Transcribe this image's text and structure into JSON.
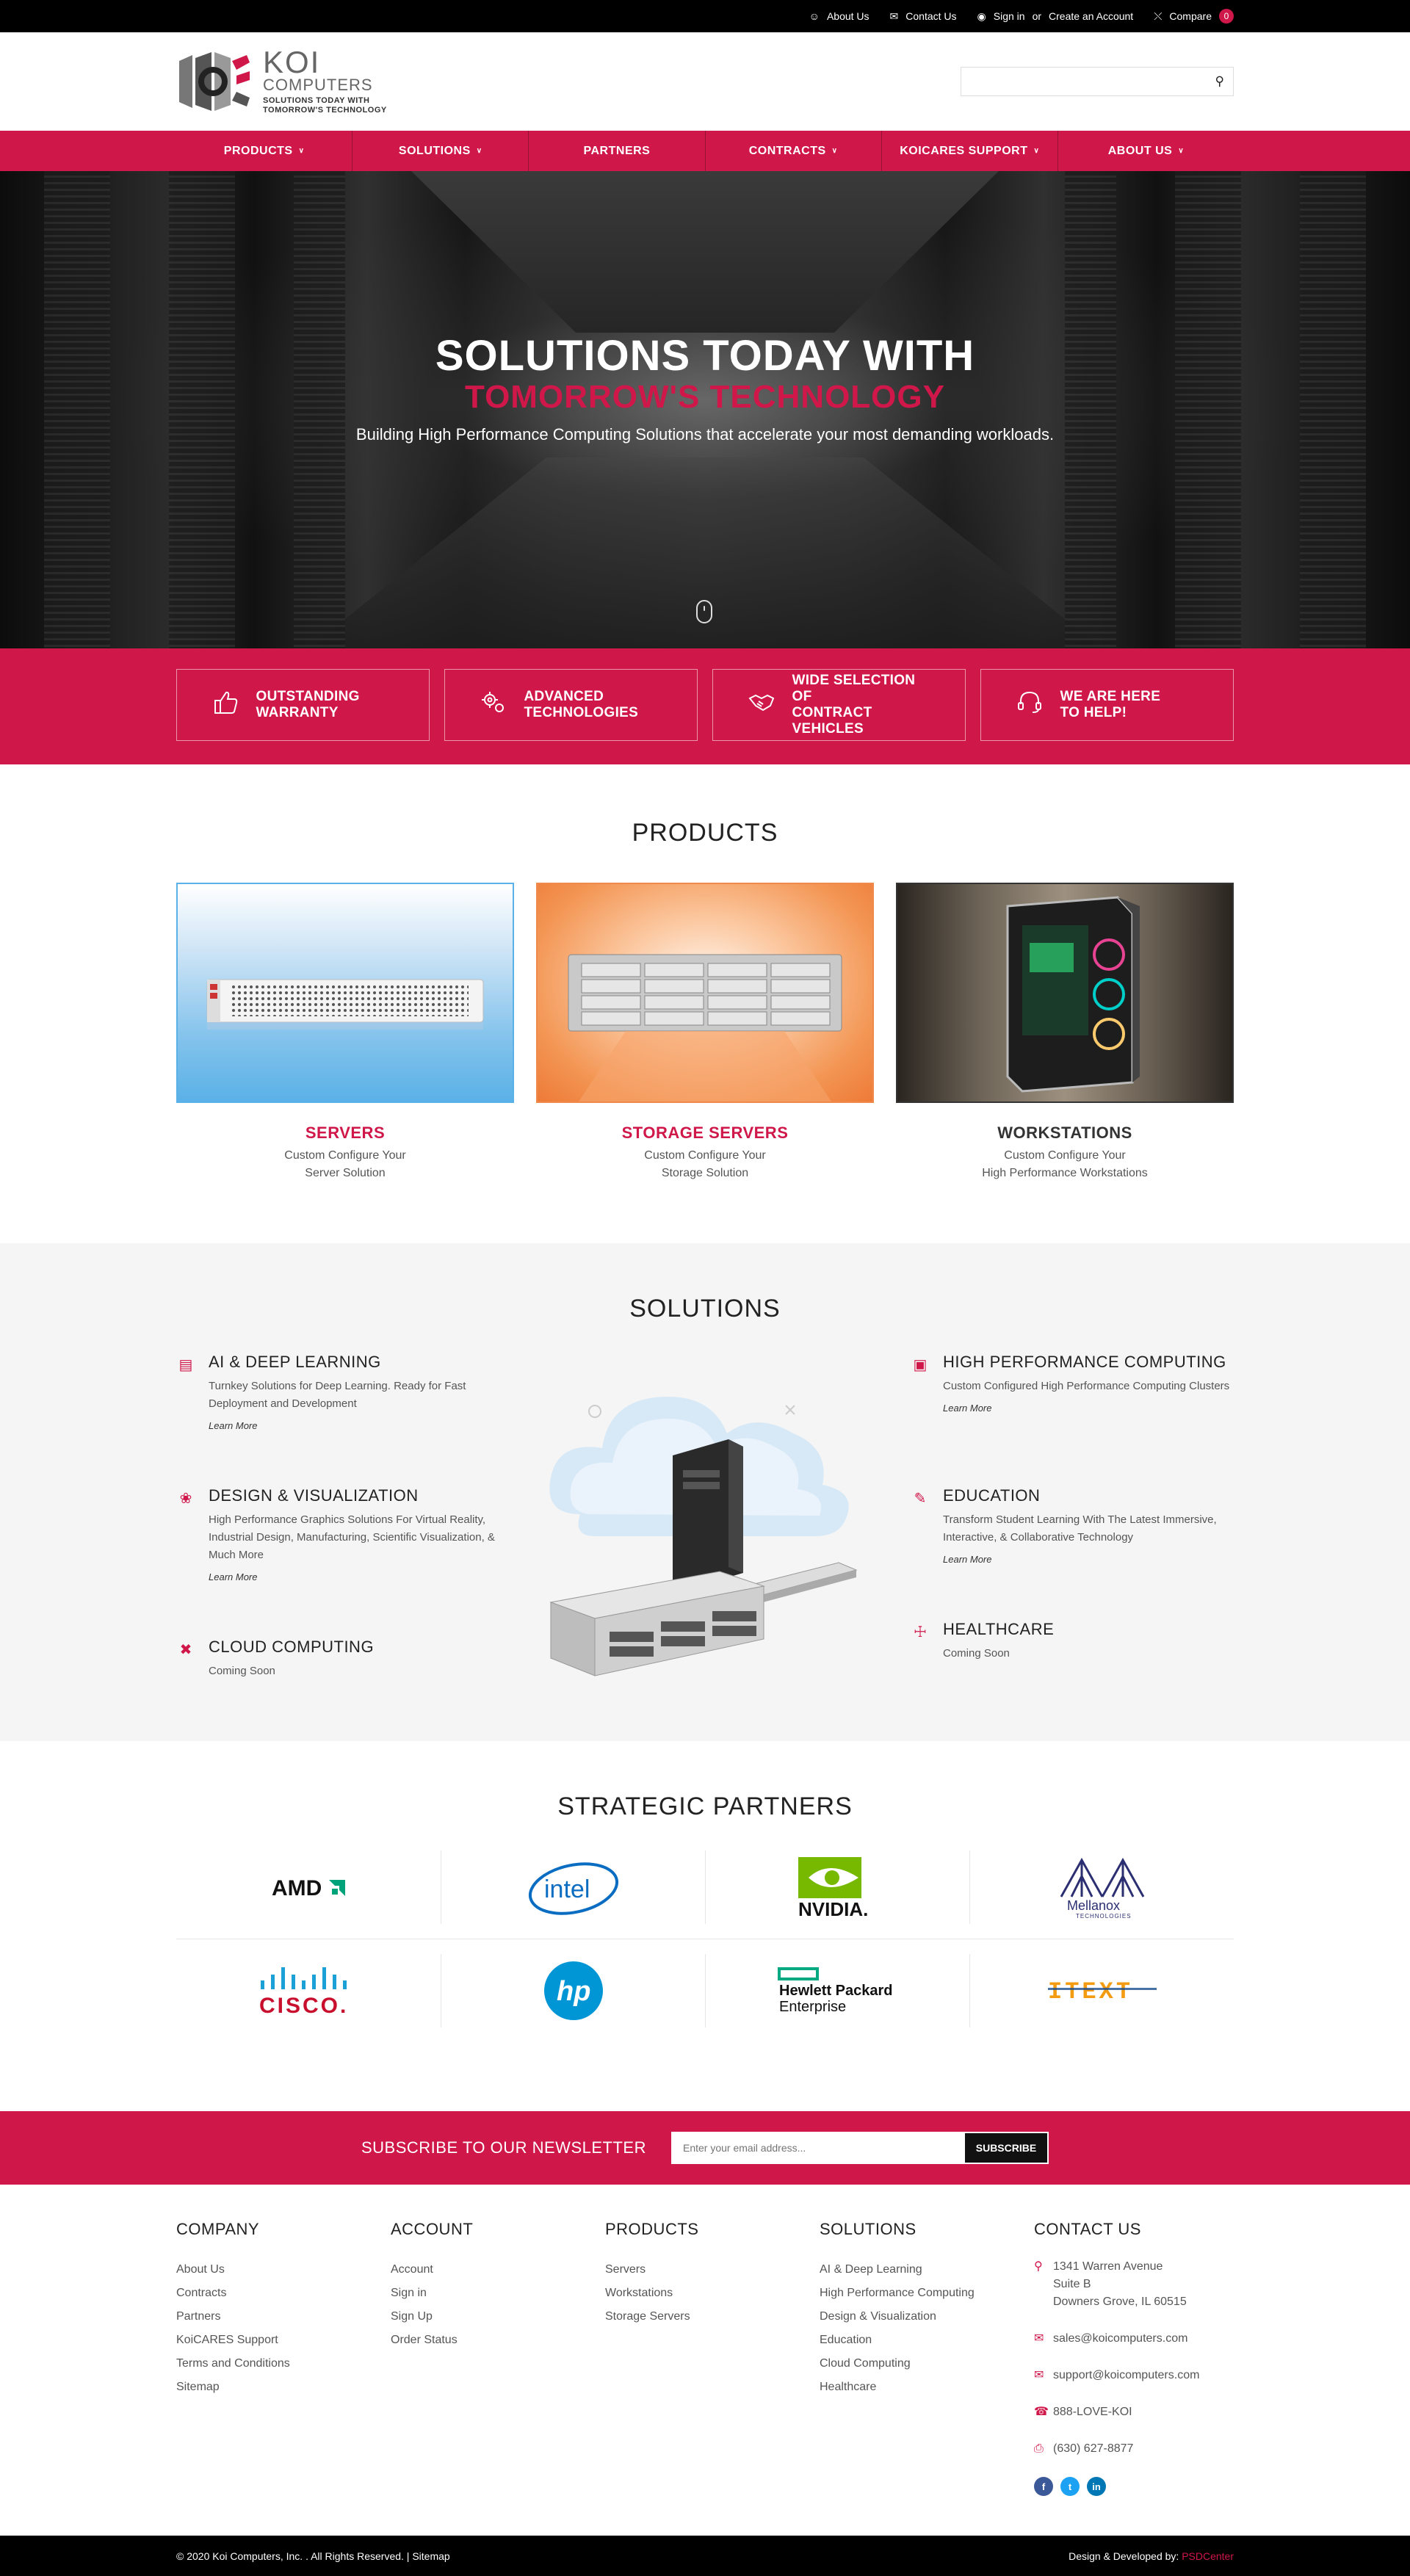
{
  "topbar": {
    "about": "About Us",
    "contact": "Contact Us",
    "signin": "Sign in",
    "or": "or",
    "create": "Create an Account",
    "compare": "Compare",
    "compare_count": "0"
  },
  "header": {
    "logo_koi": "KOI",
    "logo_computers": "COMPUTERS",
    "logo_tag_1": "SOLUTIONS TODAY WITH",
    "logo_tag_2": "TOMORROW'S TECHNOLOGY",
    "search_placeholder": ""
  },
  "nav": [
    "PRODUCTS",
    "SOLUTIONS",
    "PARTNERS",
    "CONTRACTS",
    "KOICARES SUPPORT",
    "ABOUT US"
  ],
  "hero": {
    "line1": "SOLUTIONS TODAY WITH",
    "line2": "TOMORROW'S TECHNOLOGY",
    "subtitle": "Building High Performance Computing Solutions that accelerate your most demanding workloads."
  },
  "features": [
    {
      "icon": "thumbs-up-icon",
      "line1": "OUTSTANDING",
      "line2": "WARRANTY"
    },
    {
      "icon": "gears-icon",
      "line1": "ADVANCED",
      "line2": "TECHNOLOGIES"
    },
    {
      "icon": "handshake-icon",
      "line1": "WIDE SELECTION OF",
      "line2": "CONTRACT VEHICLES"
    },
    {
      "icon": "headset-icon",
      "line1": "WE ARE HERE",
      "line2": "TO HELP!"
    }
  ],
  "products": {
    "title": "PRODUCTS",
    "items": [
      {
        "name": "SERVERS",
        "desc1": "Custom Configure Your",
        "desc2": "Server Solution",
        "color": "#d0174a"
      },
      {
        "name": "STORAGE SERVERS",
        "desc1": "Custom Configure Your",
        "desc2": "Storage Solution",
        "color": "#d0174a"
      },
      {
        "name": "WORKSTATIONS",
        "desc1": "Custom Configure Your",
        "desc2": "High Performance Workstations",
        "color": "#333333"
      }
    ]
  },
  "solutions": {
    "title": "SOLUTIONS",
    "items": [
      {
        "icon": "chip-icon",
        "title": "AI & DEEP LEARNING",
        "desc": "Turnkey Solutions for Deep Learning. Ready for Fast Deployment and Development",
        "more": "Learn More"
      },
      {
        "icon": "palette-icon",
        "title": "DESIGN & VISUALIZATION",
        "desc": "High Performance Graphics Solutions For Virtual Reality, Industrial Design, Manufacturing, Scientific Visualization, & Much More",
        "more": "Learn More"
      },
      {
        "icon": "tools-icon",
        "title": "CLOUD COMPUTING",
        "desc": "Coming Soon",
        "more": ""
      },
      {
        "icon": "laptop-icon",
        "title": "HIGH PERFORMANCE COMPUTING",
        "desc": "Custom Configured High Performance Computing Clusters",
        "more": "Learn More"
      },
      {
        "icon": "pencil-icon",
        "title": "EDUCATION",
        "desc": "Transform Student Learning With The Latest Immersive, Interactive, & Collaborative Technology",
        "more": "Learn More"
      },
      {
        "icon": "medkit-icon",
        "title": "HEALTHCARE",
        "desc": "Coming Soon",
        "more": ""
      }
    ]
  },
  "partners": {
    "title": "STRATEGIC PARTNERS",
    "logos": [
      "AMD",
      "intel",
      "NVIDIA.",
      "Mellanox",
      "CISCO.",
      "hp",
      "Hewlett Packard",
      "Enterprise",
      "ITEXT",
      "TECHNOLOGIES"
    ]
  },
  "newsletter": {
    "label": "SUBSCRIBE TO OUR NEWSLETTER",
    "placeholder": "Enter your email address...",
    "button": "SUBSCRIBE"
  },
  "footer": {
    "company": {
      "title": "COMPANY",
      "links": [
        "About Us",
        "Contracts",
        "Partners",
        "KoiCARES Support",
        "Terms and Conditions",
        "Sitemap"
      ]
    },
    "account": {
      "title": "ACCOUNT",
      "links": [
        "Account",
        "Sign in",
        "Sign Up",
        "Order Status"
      ]
    },
    "products": {
      "title": "PRODUCTS",
      "links": [
        "Servers",
        "Workstations",
        "Storage Servers"
      ]
    },
    "solutions": {
      "title": "SOLUTIONS",
      "links": [
        "AI & Deep Learning",
        "High Performance Computing",
        "Design & Visualization",
        "Education",
        "Cloud Computing",
        "Healthcare"
      ]
    },
    "contact": {
      "title": "CONTACT US",
      "address1": "1341 Warren Avenue",
      "address2": "Suite B",
      "address3": "Downers Grove, IL 60515",
      "email1": "sales@koicomputers.com",
      "email2": "support@koicomputers.com",
      "phone1": "888-LOVE-KOI",
      "phone2": "(630) 627-8877"
    },
    "social": [
      {
        "icon": "facebook-icon",
        "label": "f",
        "color": "#3b5998"
      },
      {
        "icon": "twitter-icon",
        "label": "t",
        "color": "#1da1f2"
      },
      {
        "icon": "linkedin-icon",
        "label": "in",
        "color": "#0077b5"
      }
    ]
  },
  "bottom": {
    "copyright": "© 2020 Koi Computers, Inc. . All Rights Reserved. | Sitemap",
    "credit": "Design & Developed by:",
    "credit_brand": "PSDCenter"
  },
  "colors": {
    "accent": "#d0174a",
    "dark": "#000000"
  }
}
